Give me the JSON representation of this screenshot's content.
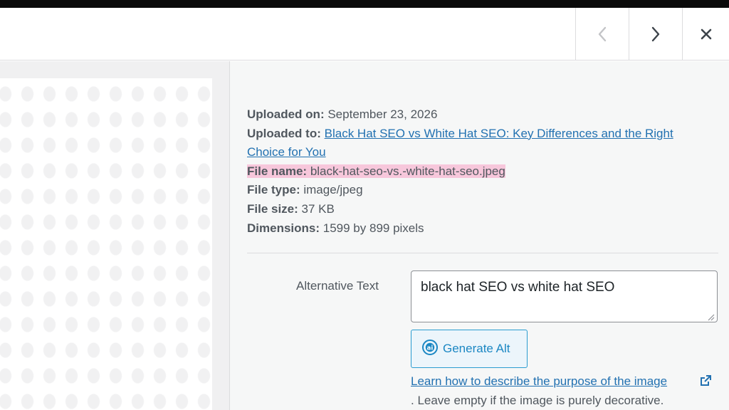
{
  "header": {
    "prev_icon": "chevron-left-icon",
    "next_icon": "chevron-right-icon",
    "close_icon": "close-icon"
  },
  "attachment": {
    "uploaded_on_label": "Uploaded on:",
    "uploaded_on": "September 23, 2026",
    "uploaded_to_label": "Uploaded to:",
    "uploaded_to": "Black Hat SEO vs White Hat SEO: Key Differences and the Right Choice for You",
    "file_name_label": "File name:",
    "file_name": "black-hat-seo-vs.-white-hat-seo.jpeg",
    "file_type_label": "File type:",
    "file_type": "image/jpeg",
    "file_size_label": "File size:",
    "file_size": "37 KB",
    "dimensions_label": "Dimensions:",
    "dimensions": "1599 by 899 pixels"
  },
  "alt": {
    "label": "Alternative Text",
    "value": "black hat SEO vs white hat SEO",
    "generate_label": "Generate Alt",
    "learn_link": "Learn how to describe the purpose of the image",
    "help": ". Leave empty if the image is purely decorative."
  },
  "colors": {
    "link": "#2271b1",
    "highlight": "#f7c7db",
    "generate_accent": "#1b87c3"
  }
}
